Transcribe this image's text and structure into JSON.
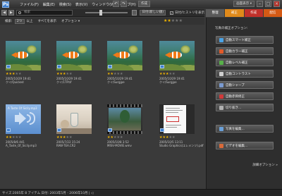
{
  "menubar": {
    "app_icon": "Ps",
    "menus": [
      "ファイル(F)",
      "編集(E)",
      "検索(S)",
      "表示(V)",
      "ウィンドウ(W)",
      "ヘルプ(H)"
    ],
    "create_label": "作成",
    "screen_mode_label": "画面表示 ▾"
  },
  "search": {
    "placeholder": "検索",
    "sort_label": "日付(新しい順)",
    "show_date_label": "日付/ヒストリを表示",
    "show_date_checked": "✓"
  },
  "filter": {
    "label_search": "検索:",
    "count_value": "2つ",
    "rating_label": "以上",
    "show_all": "すべてを表示",
    "options": "オプション ▾",
    "min_stars": 2
  },
  "tabs": {
    "organize": "整理",
    "fix": "補正",
    "create": "作成",
    "share": "配信"
  },
  "thumbnails": [
    {
      "kind": "aquarium",
      "rating": 3,
      "date": "2005/10/29 19:41",
      "name": "クイ/Quicked"
    },
    {
      "kind": "aquarium",
      "rating": 3,
      "date": "2005/10/29 19:41",
      "name": "クイ/1TP.tif"
    },
    {
      "kind": "aquarium",
      "rating": 2,
      "date": "2005/10/29 19:41",
      "name": "クイ/Surgjpe"
    },
    {
      "kind": "aquarium",
      "rating": 3,
      "date": "2005/10/29 19:41",
      "name": "クイ/Surgjpe"
    },
    {
      "kind": "audio",
      "rating": 2,
      "date": "2005/8/6 441",
      "name": "A_Taste_Of_Sicily.mp3",
      "title": "A Taste Of Sicily.mp3"
    },
    {
      "kind": "raw",
      "rating": 3,
      "date": "2005/7/22 15:24",
      "name": "RAW-TEA.CR2"
    },
    {
      "kind": "video",
      "rating": 2,
      "date": "2005/10/8 3:52",
      "name": "MISV-MOVIE.wmv"
    },
    {
      "kind": "doc",
      "rating": 3,
      "date": "2005/10/5 13:11",
      "name": "Studio Graphics(エレメンツ).pdf"
    }
  ],
  "panel": {
    "title": "写真の補正オプション:",
    "buttons": [
      {
        "label": "自動スマート補正",
        "icon_color": "#4aa3e6"
      },
      {
        "label": "自動カラー補正",
        "icon_color": "#e05a2a"
      },
      {
        "label": "自動レベル補正",
        "icon_color": "#58b04a"
      },
      {
        "label": "自動コントラスト",
        "icon_color": "#cfcfcf"
      },
      {
        "label": "自動シャープ",
        "icon_color": "#7a9ad0"
      },
      {
        "label": "自動赤目修正",
        "icon_color": "#d03a3a"
      },
      {
        "label": "切り抜き...",
        "icon_color": "#b0b0b0"
      },
      {
        "label": "写真を編集...",
        "icon_color": "#6aa0d8"
      },
      {
        "label": "ビデオを編集...",
        "icon_color": "#d86a3a"
      }
    ],
    "more": "詳細オプション »"
  },
  "status": {
    "text": "サイズ:2005年   8 アイテム  日付: 2003年5月 - 2006年10月  |  ◁"
  },
  "colors": {
    "star_on": "#f0b400",
    "fix_tab": "#e08a1a",
    "create_tab": "#c0302a"
  }
}
